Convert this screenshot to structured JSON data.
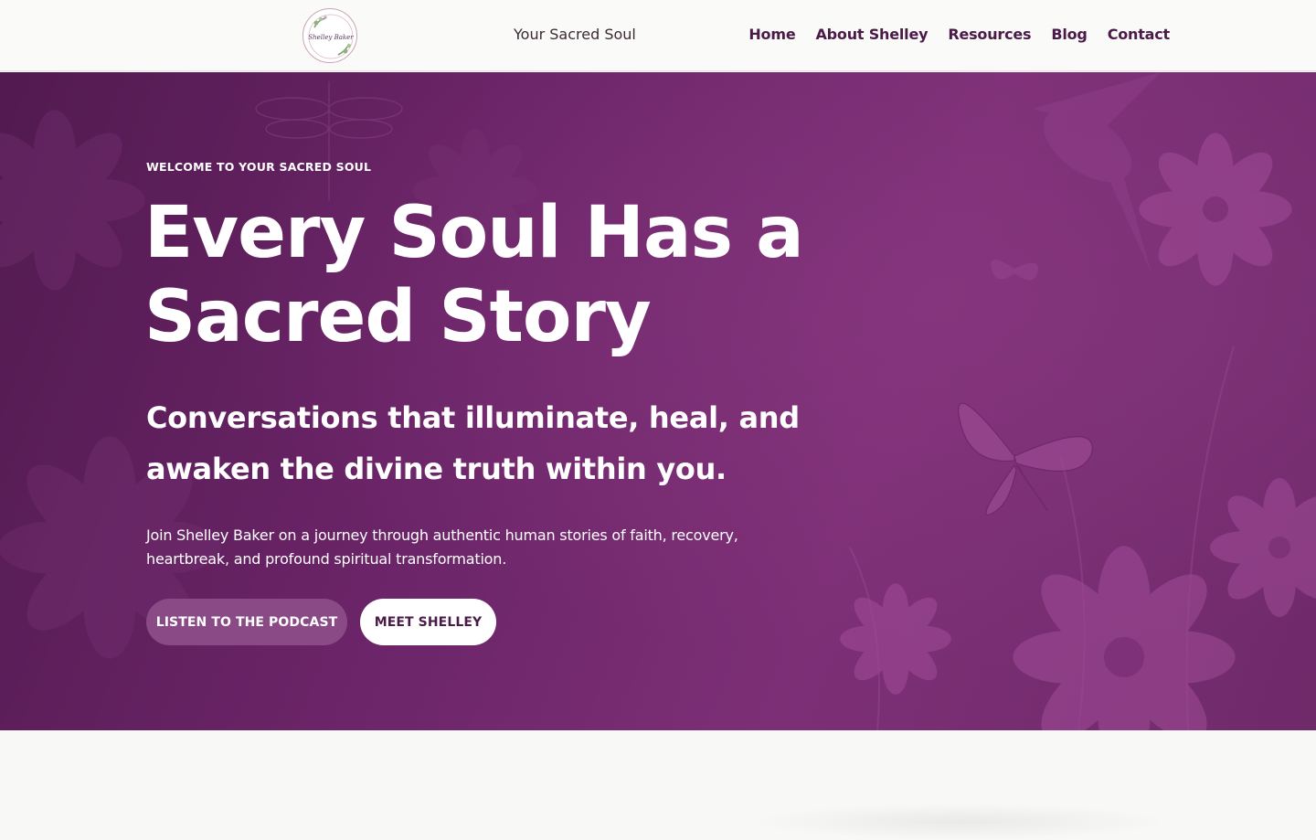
{
  "header": {
    "logo_text": "Shelley Baker",
    "site_title": "Your Sacred Soul",
    "nav": {
      "home": "Home",
      "about": "About Shelley",
      "resources": "Resources",
      "blog": "Blog",
      "contact": "Contact"
    }
  },
  "hero": {
    "eyebrow": "WELCOME TO YOUR SACRED SOUL",
    "headline": "Every Soul Has a Sacred Story",
    "subheadline": "Conversations that illuminate, heal, and awaken the divine truth within you.",
    "body": "Join Shelley Baker on a journey through authentic human stories of faith, recovery, heartbreak, and profound spiritual transformation.",
    "primary_button": "LISTEN TO THE PODCAST",
    "secondary_button": "MEET SHELLEY",
    "decorations": [
      "floral-illustration",
      "butterfly-icon",
      "hummingbird-icon",
      "dragonfly-icon"
    ]
  },
  "colors": {
    "brand_purple": "#6a2467",
    "nav_text": "#4a1a48",
    "primary_button": "#8a4a86",
    "header_bg": "#fafaf8"
  }
}
